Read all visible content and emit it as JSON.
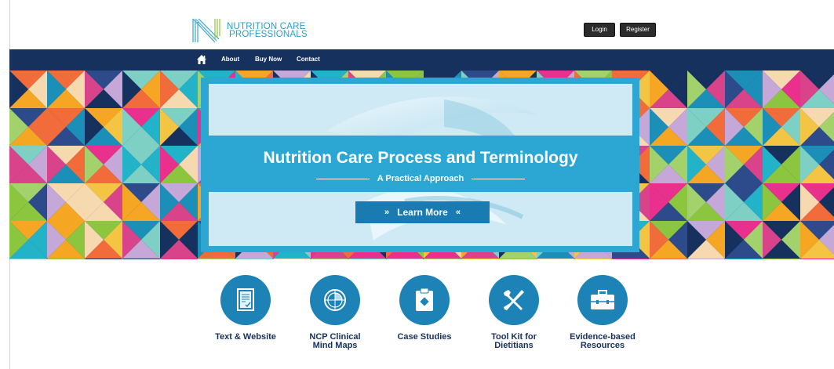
{
  "brand": {
    "line1": "NUTRITION CARE",
    "line2": "PROFESSIONALS",
    "color": "#2a9fc8"
  },
  "auth": {
    "login": "Login",
    "register": "Register"
  },
  "nav": {
    "home_icon": "home-icon",
    "items": [
      "About",
      "Buy Now",
      "Contact"
    ],
    "background": "#16315e"
  },
  "hero": {
    "title": "Nutrition Care Process and Terminology",
    "subtitle": "A Practical Approach",
    "cta_label": "Learn More",
    "cta_left_icon": "»",
    "cta_right_icon": "«",
    "accent": "#2ca6d2"
  },
  "features": [
    {
      "icon": "document-check-icon",
      "line1": "Text & Website",
      "line2": ""
    },
    {
      "icon": "mind-map-icon",
      "line1": "NCP Clinical",
      "line2": "Mind Maps"
    },
    {
      "icon": "clipboard-icon",
      "line1": "Case Studies",
      "line2": ""
    },
    {
      "icon": "tools-icon",
      "line1": "Tool Kit for",
      "line2": "Dietitians"
    },
    {
      "icon": "briefcase-icon",
      "line1": "Evidence-based",
      "line2": "Resources"
    }
  ]
}
